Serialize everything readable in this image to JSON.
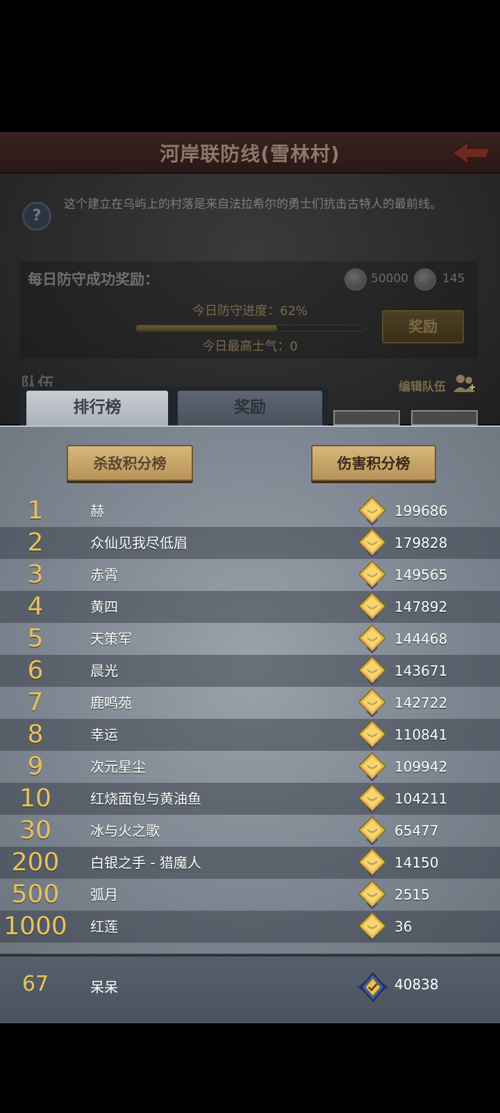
{
  "header": {
    "title": "河岸联防线(雪林村)",
    "description": "这个建立在乌屿上的村落是来自法拉希尔的勇士们抗击古特人的最前线。"
  },
  "daily_reward": {
    "label": "每日防守成功奖励：",
    "items": [
      {
        "icon": "silver-coin-icon",
        "value": "50000"
      },
      {
        "icon": "stone-icon",
        "value": "145"
      }
    ],
    "progress_label": "今日防守进度：62%",
    "progress_percent": 62,
    "morale_label": "今日最高士气：0",
    "button_label": "奖励"
  },
  "team": {
    "label": "队伍",
    "edit_label": "编辑队伍"
  },
  "tabs": [
    {
      "label": "排行榜",
      "active": true
    },
    {
      "label": "奖励",
      "active": false
    }
  ],
  "board_buttons": {
    "kill": "杀敌积分榜",
    "damage": "伤害积分榜"
  },
  "leaderboard": [
    {
      "rank": "1",
      "name": "赫",
      "score": "199686"
    },
    {
      "rank": "2",
      "name": "众仙见我尽低眉",
      "score": "179828"
    },
    {
      "rank": "3",
      "name": "赤霄",
      "score": "149565"
    },
    {
      "rank": "4",
      "name": "黄四",
      "score": "147892"
    },
    {
      "rank": "5",
      "name": "天策军",
      "score": "144468"
    },
    {
      "rank": "6",
      "name": "晨光",
      "score": "143671"
    },
    {
      "rank": "7",
      "name": "鹿鸣苑",
      "score": "142722"
    },
    {
      "rank": "8",
      "name": "幸运",
      "score": "110841"
    },
    {
      "rank": "9",
      "name": "次元星尘",
      "score": "109942"
    },
    {
      "rank": "10",
      "name": "红烧面包与黄油鱼",
      "score": "104211"
    },
    {
      "rank": "30",
      "name": "冰与火之歌",
      "score": "65477"
    },
    {
      "rank": "200",
      "name": " 白银之手 - 猎魔人",
      "score": "14150"
    },
    {
      "rank": "500",
      "name": "弧月",
      "score": "2515"
    },
    {
      "rank": "1000",
      "name": "红莲",
      "score": "36"
    }
  ],
  "self": {
    "rank": "67",
    "name": "呆呆",
    "score": "40838"
  },
  "colors": {
    "rank_gold": "#e8c25a",
    "accent_button": "#d6b77a"
  }
}
